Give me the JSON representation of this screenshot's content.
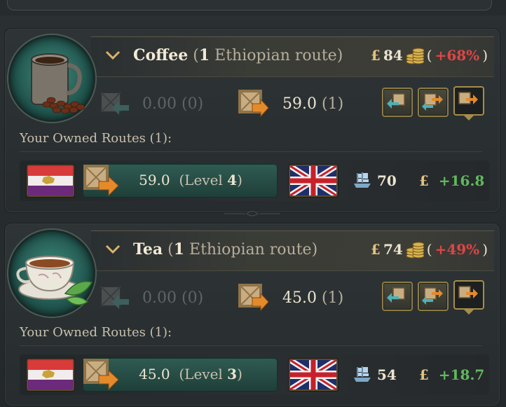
{
  "goods": [
    {
      "name": "Coffee",
      "route_count": "1",
      "route_desc": "Ethiopian route",
      "price_symbol": "£",
      "price": "84",
      "price_change": "+68%",
      "import_value": "0.00",
      "import_count": "(0)",
      "export_value": "59.0",
      "export_count": "(1)",
      "owned_label": "Your Owned Routes (1):",
      "route": {
        "value": "59.0",
        "level_label": "Level",
        "level": "4",
        "ships": "70",
        "profit_symbol": "£",
        "profit": "+16.8"
      }
    },
    {
      "name": "Tea",
      "route_count": "1",
      "route_desc": "Ethiopian route",
      "price_symbol": "£",
      "price": "74",
      "price_change": "+49%",
      "import_value": "0.00",
      "import_count": "(0)",
      "export_value": "45.0",
      "export_count": "(1)",
      "owned_label": "Your Owned Routes (1):",
      "route": {
        "value": "45.0",
        "level_label": "Level",
        "level": "3",
        "ships": "54",
        "profit_symbol": "£",
        "profit": "+18.7"
      }
    }
  ],
  "colors": {
    "accent_gold": "#e2c37e",
    "negative_red": "#e04545",
    "positive_green": "#62b85e",
    "route_bar": "#2f5b52"
  },
  "icons": {
    "collapse": "chevron-down-icon",
    "import_crate": "import-crate-icon",
    "export_crate": "export-crate-icon",
    "coins": "coins-icon",
    "ship": "ship-icon",
    "origin_flag": "ethiopia-flag-icon",
    "target_flag": "union-jack-flag-icon"
  }
}
